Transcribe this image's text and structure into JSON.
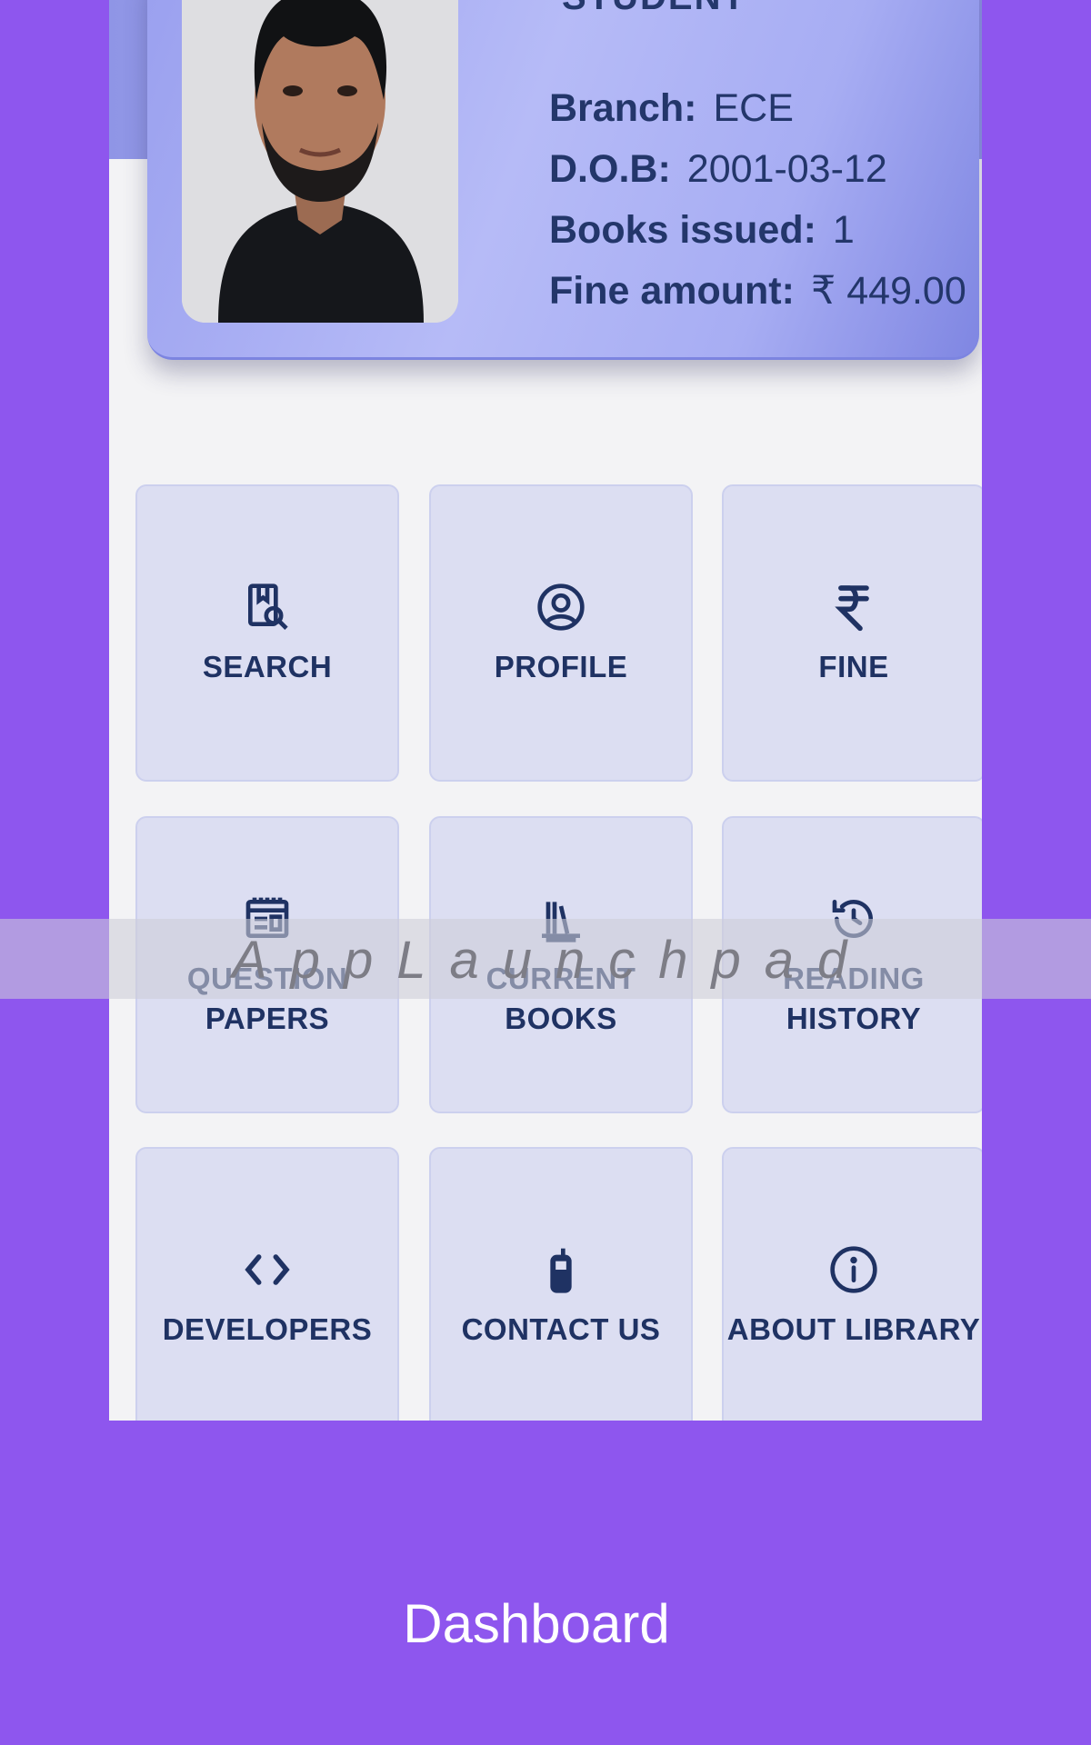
{
  "student_card": {
    "role": "STUDENT",
    "fields": [
      {
        "label": "Branch:",
        "value": "ECE"
      },
      {
        "label": "D.O.B:",
        "value": "2001-03-12"
      },
      {
        "label": "Books issued:",
        "value": "1"
      },
      {
        "label": "Fine amount:",
        "value": "₹ 449.00"
      }
    ]
  },
  "menu": [
    {
      "label": "SEARCH",
      "icon": "book-search-icon"
    },
    {
      "label": "PROFILE",
      "icon": "user-circle-icon"
    },
    {
      "label": "FINE",
      "icon": "rupee-icon"
    },
    {
      "label": "QUESTION PAPERS",
      "icon": "newspaper-icon"
    },
    {
      "label": "CURRENT BOOKS",
      "icon": "books-shelf-icon"
    },
    {
      "label": "READING HISTORY",
      "icon": "history-icon"
    },
    {
      "label": "DEVELOPERS",
      "icon": "code-icon"
    },
    {
      "label": "CONTACT US",
      "icon": "mobile-phone-icon"
    },
    {
      "label": "ABOUT LIBRARY",
      "icon": "info-icon"
    }
  ],
  "watermark": "AppLaunchpad",
  "caption": "Dashboard"
}
